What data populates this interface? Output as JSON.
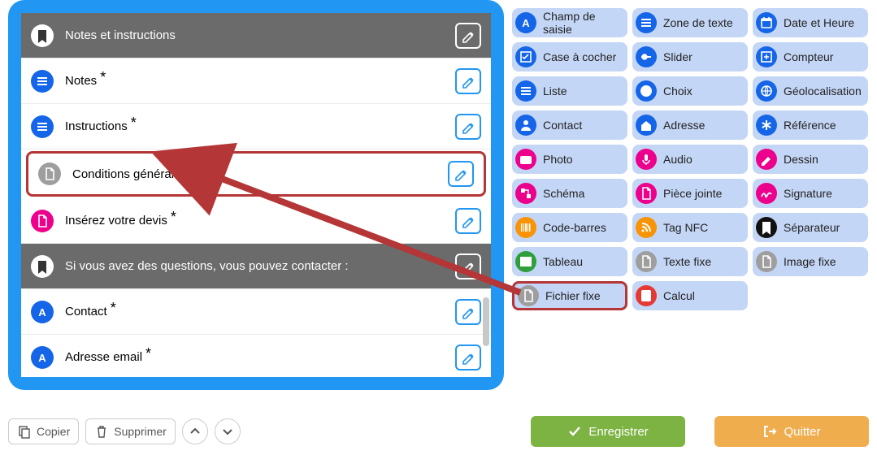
{
  "panel": {
    "rows": [
      {
        "kind": "header",
        "icon": "bookmark",
        "label": "Notes et instructions"
      },
      {
        "kind": "item",
        "icon": "lines-blue",
        "label": "Notes",
        "required": true
      },
      {
        "kind": "item",
        "icon": "lines-blue",
        "label": "Instructions",
        "required": true
      },
      {
        "kind": "item",
        "icon": "file-gray",
        "label": "Conditions générales",
        "required": false,
        "highlight": true
      },
      {
        "kind": "item",
        "icon": "file-magenta",
        "label": "Insérez votre devis",
        "required": true
      },
      {
        "kind": "header",
        "icon": "bookmark",
        "label": "Si vous avez des questions, vous pouvez contacter :"
      },
      {
        "kind": "item",
        "icon": "letter-a",
        "label": "Contact",
        "required": true
      },
      {
        "kind": "item",
        "icon": "letter-a",
        "label": "Adresse email",
        "required": true
      }
    ]
  },
  "palette": {
    "col1": [
      {
        "icon": "letter-a",
        "cls": "ic-blue",
        "label": "Champ de saisie"
      },
      {
        "icon": "checkbox",
        "cls": "ic-blue",
        "label": "Case à cocher"
      },
      {
        "icon": "lines",
        "cls": "ic-blue",
        "label": "Liste"
      },
      {
        "icon": "person",
        "cls": "ic-blue",
        "label": "Contact"
      },
      {
        "icon": "camera",
        "cls": "ic-magenta",
        "label": "Photo"
      },
      {
        "icon": "schema",
        "cls": "ic-magenta",
        "label": "Schéma"
      },
      {
        "icon": "barcode",
        "cls": "ic-orange",
        "label": "Code-barres"
      },
      {
        "icon": "table",
        "cls": "ic-green",
        "label": "Tableau"
      },
      {
        "icon": "file",
        "cls": "ic-gray",
        "label": "Fichier fixe",
        "highlight": true
      }
    ],
    "col2": [
      {
        "icon": "lines",
        "cls": "ic-blue",
        "label": "Zone de texte"
      },
      {
        "icon": "slider",
        "cls": "ic-blue",
        "label": "Slider"
      },
      {
        "icon": "check",
        "cls": "ic-blue",
        "label": "Choix"
      },
      {
        "icon": "home",
        "cls": "ic-blue",
        "label": "Adresse"
      },
      {
        "icon": "mic",
        "cls": "ic-magenta",
        "label": "Audio"
      },
      {
        "icon": "file",
        "cls": "ic-magenta",
        "label": "Pièce jointe"
      },
      {
        "icon": "rss",
        "cls": "ic-orange",
        "label": "Tag NFC"
      },
      {
        "icon": "file",
        "cls": "ic-gray",
        "label": "Texte fixe"
      },
      {
        "icon": "calc",
        "cls": "ic-red",
        "label": "Calcul"
      }
    ],
    "col3": [
      {
        "icon": "calendar",
        "cls": "ic-blue",
        "label": "Date et Heure"
      },
      {
        "icon": "plus-box",
        "cls": "ic-blue",
        "label": "Compteur"
      },
      {
        "icon": "globe",
        "cls": "ic-blue",
        "label": "Géolocalisation"
      },
      {
        "icon": "asterisk",
        "cls": "ic-blue",
        "label": "Référence"
      },
      {
        "icon": "pencil",
        "cls": "ic-magenta",
        "label": "Dessin"
      },
      {
        "icon": "sig",
        "cls": "ic-magenta",
        "label": "Signature"
      },
      {
        "icon": "bookmark",
        "cls": "ic-black",
        "label": "Séparateur"
      },
      {
        "icon": "file",
        "cls": "ic-gray",
        "label": "Image fixe"
      }
    ]
  },
  "toolbar": {
    "copy": "Copier",
    "delete": "Supprimer",
    "save": "Enregistrer",
    "quit": "Quitter"
  }
}
